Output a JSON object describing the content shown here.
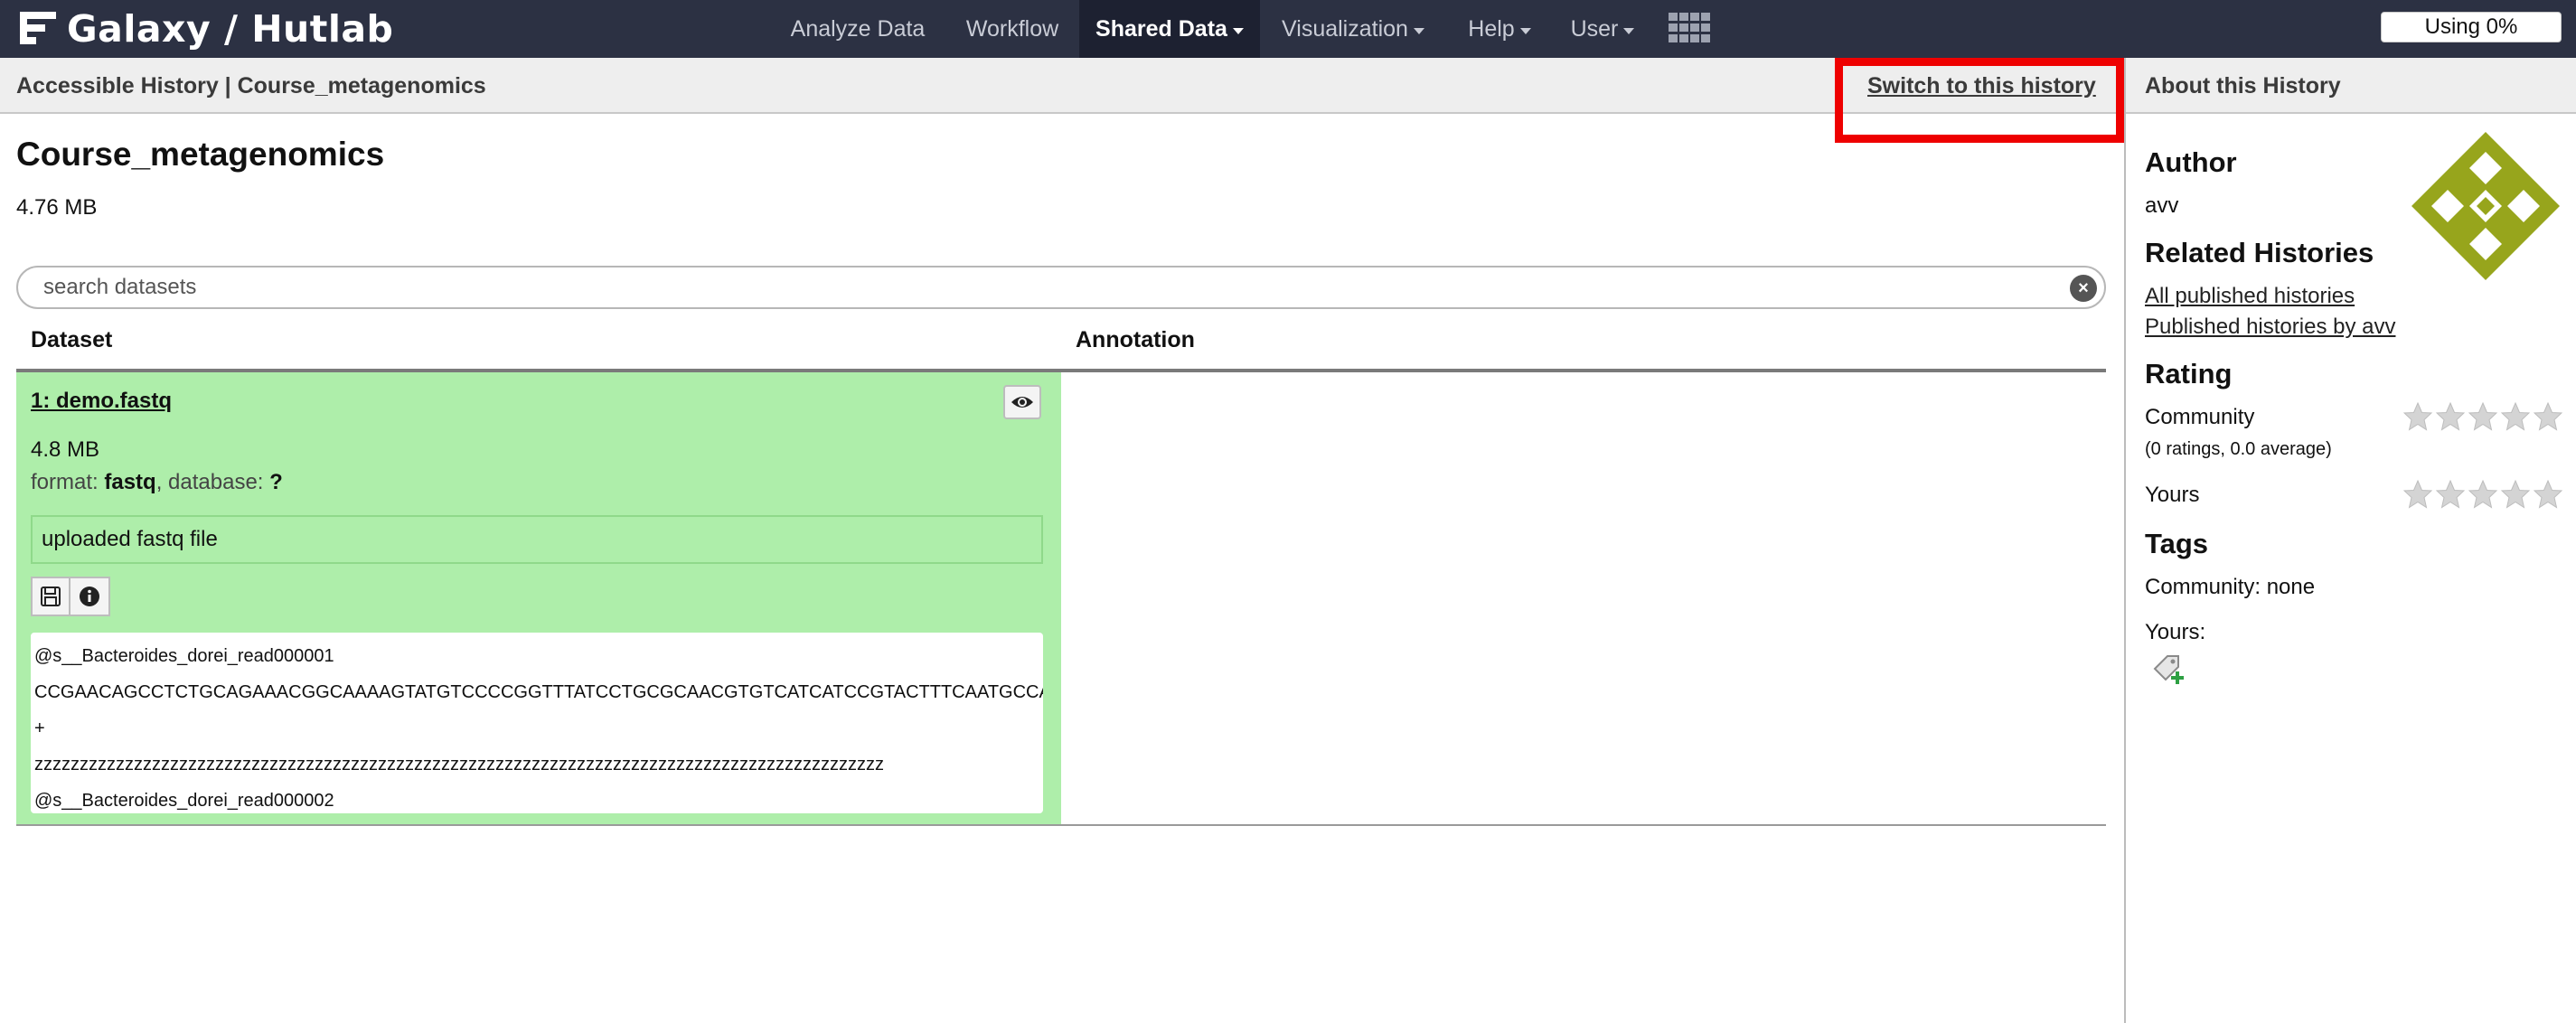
{
  "masthead": {
    "brand": "Galaxy / Hutlab",
    "nav": [
      {
        "label": "Analyze Data",
        "dropdown": false,
        "active": false
      },
      {
        "label": "Workflow",
        "dropdown": false,
        "active": false
      },
      {
        "label": "Shared Data",
        "dropdown": true,
        "active": true
      },
      {
        "label": "Visualization",
        "dropdown": true,
        "active": false
      },
      {
        "label": "Help",
        "dropdown": true,
        "active": false
      },
      {
        "label": "User",
        "dropdown": true,
        "active": false
      }
    ],
    "apps_icon": "grid-icon",
    "quota": "Using 0%",
    "colors": {
      "bar": "#2c3143",
      "active_tab": "#1d2131"
    }
  },
  "header": {
    "breadcrumb": "Accessible History | Course_metagenomics",
    "switch_link": "Switch to this history",
    "about_title": "About this History",
    "highlight_color": "#ee0000"
  },
  "history": {
    "title": "Course_metagenomics",
    "size": "4.76 MB",
    "search_placeholder": "search datasets",
    "columns": [
      "Dataset",
      "Annotation"
    ]
  },
  "dataset": {
    "title": "1: demo.fastq",
    "size": "4.8 MB",
    "format_label": "format: ",
    "format_value": "fastq",
    "database_label": ", database: ",
    "database_value": "?",
    "info": "uploaded fastq file",
    "actions": [
      "save-icon",
      "info-icon"
    ],
    "peek": [
      "@s__Bacteroides_dorei_read000001",
      "CCGAACAGCCTCTGCAGAAACGGCAAAAGTATGTCCCCGGTTTATCCTGCGCAACGTGTCATCATCCGTACTTTCAATGCCATACTCCACTAA",
      "+",
      "zzzzzzzzzzzzzzzzzzzzzzzzzzzzzzzzzzzzzzzzzzzzzzzzzzzzzzzzzzzzzzzzzzzzzzzzzzzzzzzzzzzzzzzzzzzzzz",
      "@s__Bacteroides_dorei_read000002"
    ],
    "bg_color": "#aeeeaa"
  },
  "sidebar": {
    "author_heading": "Author",
    "author": "avv",
    "related_heading": "Related Histories",
    "related_links": [
      "All published histories",
      "Published histories by avv"
    ],
    "rating_heading": "Rating",
    "community_label": "Community",
    "community_rating_note": "(0 ratings, 0.0 average)",
    "community_stars": 0,
    "yours_label": "Yours",
    "yours_stars": 0,
    "tags_heading": "Tags",
    "community_tags": "Community: none",
    "yours_tags_label": "Yours:",
    "avatar_color": "#97a51c"
  }
}
